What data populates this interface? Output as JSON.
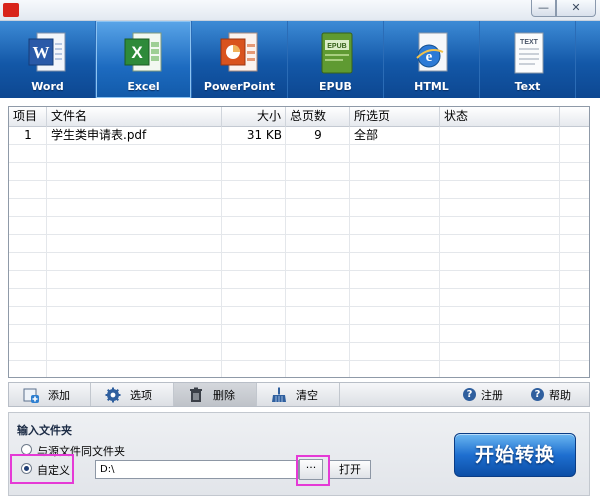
{
  "window": {
    "min_glyph": "—",
    "close_glyph": "✕"
  },
  "formats": [
    {
      "label": "Word",
      "icon": "word-icon",
      "active": false
    },
    {
      "label": "Excel",
      "icon": "excel-icon",
      "active": true
    },
    {
      "label": "PowerPoint",
      "icon": "powerpoint-icon",
      "active": false
    },
    {
      "label": "EPUB",
      "icon": "epub-icon",
      "active": false
    },
    {
      "label": "HTML",
      "icon": "html-icon",
      "active": false
    },
    {
      "label": "Text",
      "icon": "text-icon",
      "active": false
    }
  ],
  "icon_text": {
    "word": "W",
    "excel": "X",
    "epub": "EPUB",
    "text": "TEXT"
  },
  "table": {
    "columns": [
      "项目",
      "文件名",
      "大小",
      "总页数",
      "所选页",
      "状态"
    ],
    "rows": [
      {
        "index": "1",
        "filename": "学生类申请表.pdf",
        "size": "31  KB",
        "pages": "9",
        "selected": "全部",
        "status": ""
      }
    ]
  },
  "actions": {
    "add": "添加",
    "options": "选项",
    "delete": "删除",
    "clear": "清空",
    "register": "注册",
    "help": "帮助"
  },
  "output": {
    "title": "输入文件夹",
    "option_same": "与源文件同文件夹",
    "option_custom": "自定义",
    "path": "D:\\",
    "browse": "···",
    "open": "打开"
  },
  "start_button": "开始转换",
  "colors": {
    "toolbar": "#1358a8",
    "highlight": "#e53ad6",
    "start": "#1e6fd0"
  }
}
